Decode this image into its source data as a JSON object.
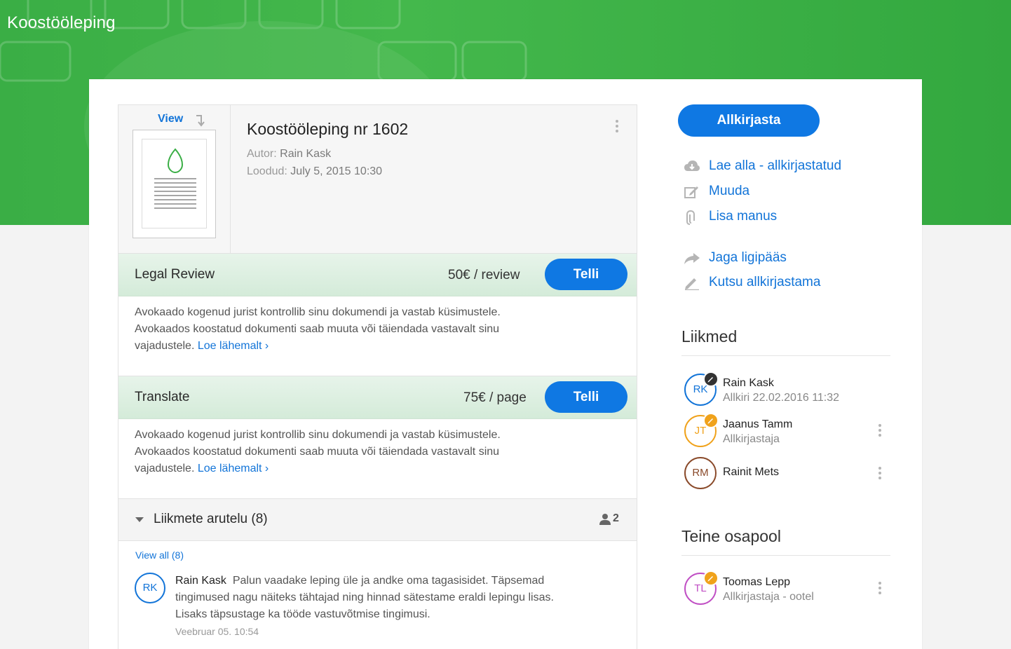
{
  "header": {
    "title": "Koostööleping"
  },
  "document": {
    "view_label": "View",
    "title": "Koostööleping nr 1602",
    "author_label": "Autor:",
    "author": "Rain Kask",
    "created_label": "Loodud:",
    "created": "July 5, 2015 10:30"
  },
  "services": [
    {
      "name": "Legal Review",
      "price": "50€ / review",
      "button": "Telli",
      "description": [
        "Avokaado kogenud jurist kontrollib sinu dokumendi ja vastab küsimustele.",
        "Avokaados koostatud dokumenti saab muuta või täiendada vastavalt sinu",
        "vajadustele."
      ],
      "more_link": "Loe lähemalt ›"
    },
    {
      "name": "Translate",
      "price": "75€ / page",
      "button": "Telli",
      "description": [
        "Avokaado kogenud jurist kontrollib sinu dokumendi ja vastab küsimustele.",
        "Avokaados koostatud dokumenti saab muuta või täiendada vastavalt sinu",
        "vajadustele."
      ],
      "more_link": "Loe lähemalt ›"
    }
  ],
  "discussion": {
    "title": "Liikmete arutelu (8)",
    "participants": "2",
    "view_all": "View all (8)",
    "comment": {
      "initials": "RK",
      "author": "Rain Kask",
      "lines": [
        "Palun vaadake leping üle ja andke oma tagasisidet. Täpsemad",
        "tingimused nagu näiteks tähtajad ning hinnad sätestame eraldi lepingu lisas.",
        "Lisaks täpsustage ka tööde vastuvõtmise tingimusi."
      ],
      "time": "Veebruar 05. 10:54"
    }
  },
  "sidebar": {
    "sign_button": "Allkirjasta",
    "actions": [
      {
        "label": "Lae alla - allkirjastatud",
        "icon": "cloud-download-icon"
      },
      {
        "label": "Muuda",
        "icon": "edit-icon"
      },
      {
        "label": "Lisa manus",
        "icon": "paperclip-icon"
      },
      {
        "label": "Jaga ligipääs",
        "icon": "share-icon"
      },
      {
        "label": "Kutsu allkirjastama",
        "icon": "pen-icon"
      }
    ],
    "members_title": "Liikmed",
    "members": [
      {
        "initials": "RK",
        "name": "Rain Kask",
        "status": "Allkiri 22.02.2016 11:32",
        "color": "#1274d8",
        "badge_color": "#333333"
      },
      {
        "initials": "JT",
        "name": "Jaanus Tamm",
        "status": "Allkirjastaja",
        "color": "#f0a21b",
        "badge_color": "#f0a21b"
      },
      {
        "initials": "RM",
        "name": "Rainit Mets",
        "status": "",
        "color": "#8a4a2a",
        "badge_color": ""
      }
    ],
    "other_party_title": "Teine osapool",
    "other_party": [
      {
        "initials": "TL",
        "name": "Toomas Lepp",
        "status": "Allkirjastaja - ootel",
        "color": "#c04fc4",
        "badge_color": "#f0a21b"
      }
    ]
  },
  "colors": {
    "brand_green": "#3aae45",
    "accent_blue": "#0f78e3"
  }
}
